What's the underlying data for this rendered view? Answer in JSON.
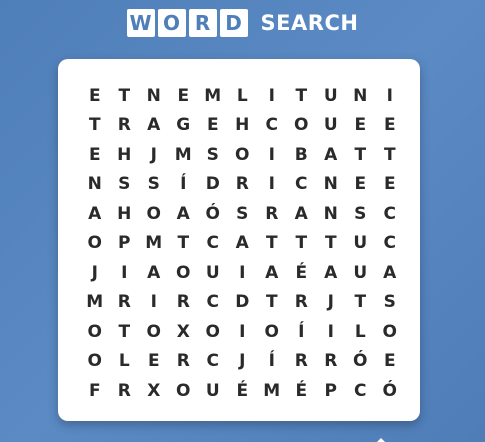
{
  "title": {
    "word_letters": [
      "W",
      "O",
      "R",
      "D"
    ],
    "search_label": "SEARCH"
  },
  "colors": {
    "background": "#5585bf",
    "tile_text": "#4f7fb8",
    "letter": "#2a2a2a"
  },
  "grid": [
    [
      "E",
      "T",
      "N",
      "E",
      "M",
      "L",
      "I",
      "T",
      "U",
      "N",
      "I"
    ],
    [
      "T",
      "R",
      "A",
      "G",
      "E",
      "H",
      "C",
      "O",
      "U",
      "E",
      "E"
    ],
    [
      "E",
      "H",
      "J",
      "M",
      "S",
      "O",
      "I",
      "B",
      "A",
      "T",
      "T"
    ],
    [
      "N",
      "S",
      "S",
      "Í",
      "D",
      "R",
      "I",
      "C",
      "N",
      "E",
      "E"
    ],
    [
      "A",
      "H",
      "O",
      "A",
      "Ó",
      "S",
      "R",
      "A",
      "N",
      "S",
      "C"
    ],
    [
      "O",
      "P",
      "M",
      "T",
      "C",
      "A",
      "T",
      "T",
      "T",
      "U",
      "C"
    ],
    [
      "J",
      "I",
      "A",
      "O",
      "U",
      "I",
      "A",
      "É",
      "A",
      "U",
      "A"
    ],
    [
      "M",
      "R",
      "I",
      "R",
      "C",
      "D",
      "T",
      "R",
      "J",
      "T",
      "S"
    ],
    [
      "O",
      "T",
      "O",
      "X",
      "O",
      "I",
      "O",
      "Í",
      "I",
      "L",
      "O"
    ],
    [
      "O",
      "L",
      "E",
      "R",
      "C",
      "J",
      "Í",
      "R",
      "R",
      "Ó",
      "E"
    ],
    [
      "F",
      "R",
      "X",
      "O",
      "U",
      "É",
      "M",
      "É",
      "P",
      "C",
      "Ó"
    ]
  ]
}
